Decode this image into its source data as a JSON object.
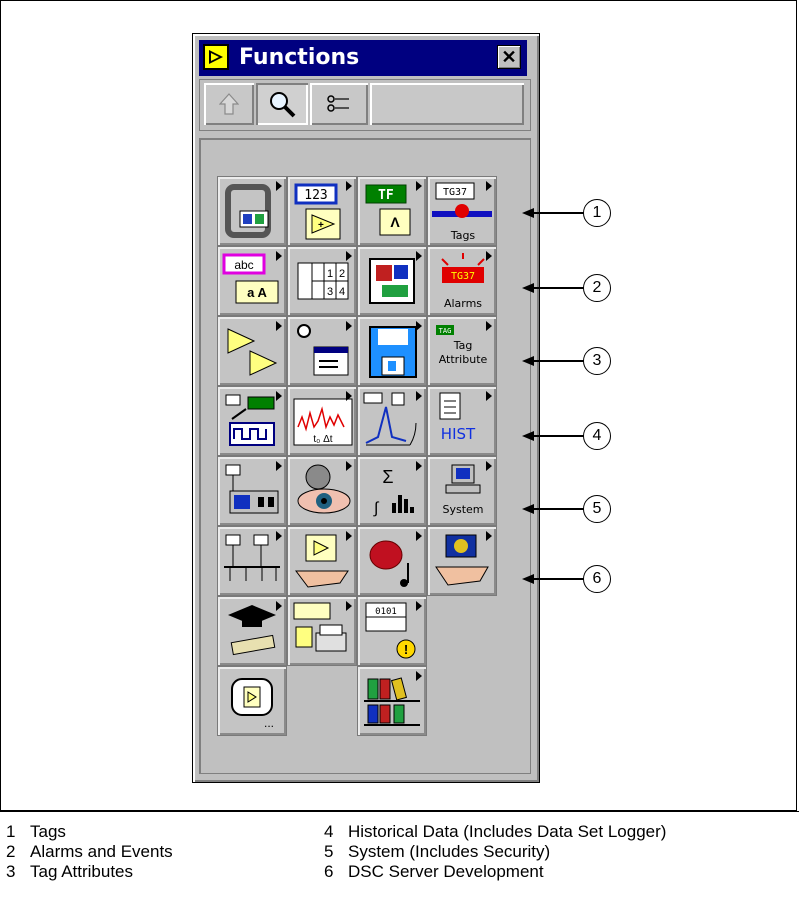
{
  "window": {
    "title": "Functions",
    "close_label": "✕"
  },
  "toolbar": {
    "buttons": [
      "up-arrow-icon",
      "magnifier-icon",
      "options-icon",
      "blank"
    ]
  },
  "tiles": [
    {
      "name": "structures-icon",
      "label": ""
    },
    {
      "name": "numeric-icon",
      "label": "",
      "glyph": "123"
    },
    {
      "name": "boolean-icon",
      "label": "",
      "glyph": "TF"
    },
    {
      "name": "tags-icon",
      "label": "Tags",
      "glyph": "TG37"
    },
    {
      "name": "string-icon",
      "label": "",
      "glyph": "abc"
    },
    {
      "name": "array-icon",
      "label": ""
    },
    {
      "name": "cluster-icon",
      "label": ""
    },
    {
      "name": "alarms-icon",
      "label": "Alarms",
      "glyph": "TG37"
    },
    {
      "name": "comparison-icon",
      "label": ""
    },
    {
      "name": "time-dialog-icon",
      "label": ""
    },
    {
      "name": "file-io-icon",
      "label": ""
    },
    {
      "name": "tag-attribute-icon",
      "label": "Tag Attribute",
      "glyph": "TAG"
    },
    {
      "name": "data-acquisition-icon",
      "label": ""
    },
    {
      "name": "waveform-icon",
      "label": "",
      "glyph": "t₀  Δt"
    },
    {
      "name": "analyze-icon",
      "label": ""
    },
    {
      "name": "historical-icon",
      "label": "",
      "glyph": "HIST"
    },
    {
      "name": "instrument-io-icon",
      "label": ""
    },
    {
      "name": "motion-vision-icon",
      "label": ""
    },
    {
      "name": "mathematics-icon",
      "label": ""
    },
    {
      "name": "system-icon",
      "label": "System"
    },
    {
      "name": "communication-icon",
      "label": ""
    },
    {
      "name": "application-control-icon",
      "label": ""
    },
    {
      "name": "graphics-sound-icon",
      "label": ""
    },
    {
      "name": "dsc-server-icon",
      "label": ""
    },
    {
      "name": "tutorial-icon",
      "label": ""
    },
    {
      "name": "report-generation-icon",
      "label": ""
    },
    {
      "name": "advanced-icon",
      "label": ""
    },
    {
      "name": "select-vi-icon",
      "label": ""
    },
    {
      "name": "user-libraries-icon",
      "label": ""
    }
  ],
  "callouts": [
    "1",
    "2",
    "3",
    "4",
    "5",
    "6"
  ],
  "legend": [
    {
      "num": "1",
      "text": "Tags"
    },
    {
      "num": "2",
      "text": "Alarms and Events"
    },
    {
      "num": "3",
      "text": "Tag Attributes"
    },
    {
      "num": "4",
      "text": "Historical Data (Includes Data Set Logger)"
    },
    {
      "num": "5",
      "text": "System (Includes Security)"
    },
    {
      "num": "6",
      "text": "DSC Server Development"
    }
  ]
}
